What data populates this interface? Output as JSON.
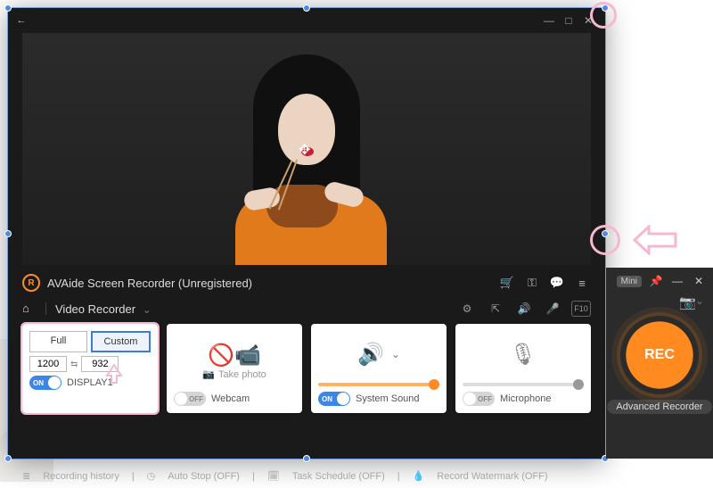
{
  "window": {
    "title": "AVAide Screen Recorder (Unregistered)"
  },
  "subheader": {
    "section": "Video Recorder"
  },
  "cards": {
    "area": {
      "full_label": "Full",
      "custom_label": "Custom",
      "width": "1200",
      "height": "932",
      "toggle_on_label": "ON",
      "display_label": "DISPLAY1"
    },
    "webcam": {
      "take_photo_label": "Take photo",
      "toggle_off_label": "OFF",
      "label": "Webcam"
    },
    "sound": {
      "toggle_on_label": "ON",
      "label": "System Sound"
    },
    "mic": {
      "toggle_off_label": "OFF",
      "label": "Microphone"
    }
  },
  "sidepanel": {
    "mini_label": "Mini",
    "rec_label": "REC",
    "advanced_label": "Advanced Recorder"
  },
  "status": {
    "history": "Recording history",
    "auto_stop": "Auto Stop (OFF)",
    "task_schedule": "Task Schedule (OFF)",
    "watermark": "Record Watermark (OFF)"
  },
  "icons": {
    "back": "←",
    "minimize": "—",
    "maximize": "□",
    "close": "✕",
    "cart": "🛒",
    "key": "⚿",
    "chat": "💬",
    "menu": "≡",
    "home": "⌂",
    "chevron_down": "⌄",
    "gear": "⚙",
    "export": "⇱",
    "speaker_small": "🔊",
    "mic_small": "🎤",
    "f10": "F10",
    "camera": "📷",
    "pin": "📌",
    "dash": "—",
    "x": "✕",
    "move": "✥",
    "nav_left": "‹",
    "nav_right": "›",
    "history": "≣",
    "clock": "◷",
    "calendar": "🗓",
    "drop": "💧",
    "swap": "⇆",
    "photo": "📷",
    "sound_big": "🔊",
    "mic_big": "🎙"
  }
}
